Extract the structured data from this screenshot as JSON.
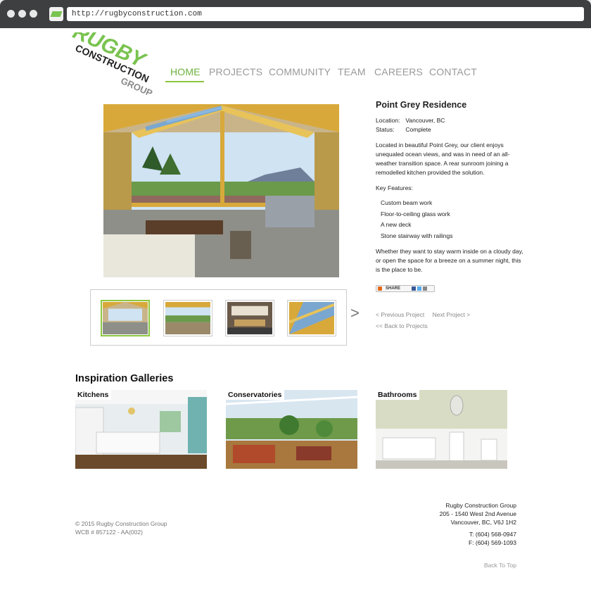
{
  "browser": {
    "url": "http://rugbyconstruction.com"
  },
  "logo": {
    "line1": "RUGBY",
    "line2": "CONSTRUCTION",
    "line3": "GROUP"
  },
  "nav": {
    "items": [
      {
        "label": "HOME",
        "active": true
      },
      {
        "label": "PROJECTS"
      },
      {
        "label": "COMMUNITY"
      },
      {
        "label": "TEAM"
      },
      {
        "label": "CAREERS"
      },
      {
        "label": "CONTACT"
      }
    ]
  },
  "project": {
    "title": "Point Grey Residence",
    "location_label": "Location:",
    "location": "Vancouver, BC",
    "status_label": "Status:",
    "status": "Complete",
    "description": "Located in beautiful Point Grey, our client enjoys unequaled ocean views, and was in need of an all-weather transition space. A rear sunroom joining a remodelled kitchen provided the solution.",
    "features_heading": "Key Features:",
    "features": [
      "Custom beam work",
      "Floor-to-ceiling glass work",
      "A new deck",
      "Stone stairway with railings"
    ],
    "closing": "Whether they want to stay warm inside on a cloudy day, or open the space for a breeze on a summer night, this is the place to be."
  },
  "share": {
    "label": "SHARE"
  },
  "pager": {
    "prev": "< Previous Project",
    "next": "Next Project >",
    "back": "<< Back to Projects"
  },
  "thumbnails": {
    "next_arrow": ">"
  },
  "galleries": {
    "title": "Inspiration Galleries",
    "items": [
      {
        "label": "Kitchens"
      },
      {
        "label": "Conservatories"
      },
      {
        "label": "Bathrooms"
      }
    ]
  },
  "footer": {
    "copyright": "© 2015 Rugby Construction Group",
    "wcb": "WCB # 857122 - AA(002)",
    "company": "Rugby Construction Group",
    "address1": "205 - 1540 West 2nd Avenue",
    "address2": "Vancouver, BC, V6J 1H2",
    "phone": "T: (604) 568-0947",
    "fax": "F: (604) 569-1093",
    "back_to_top": "Back To Top"
  },
  "colors": {
    "brand_green": "#79c34f",
    "logo_gray": "#888888",
    "nav_gray": "#999999"
  }
}
